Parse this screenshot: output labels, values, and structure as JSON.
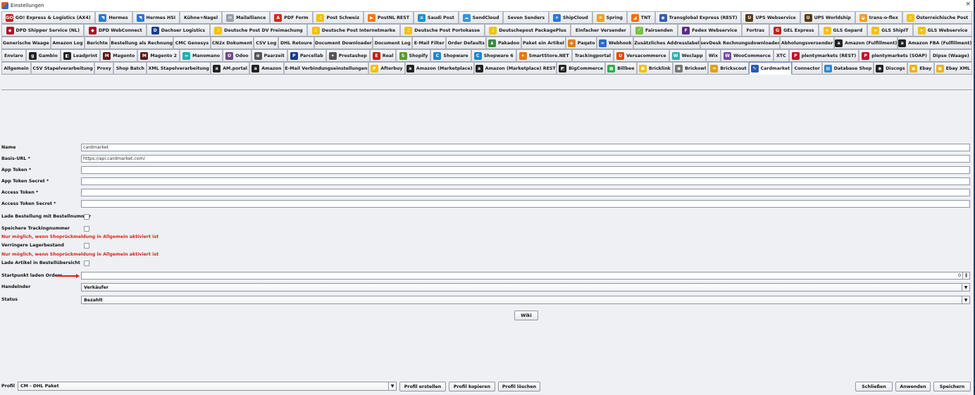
{
  "window": {
    "title": "Einstellungen",
    "close_glyph": "×"
  },
  "tab_rows": [
    [
      {
        "label": "GO! Express & Logistics (AX4)",
        "icon": "go-logo-icon",
        "color": "#c8201e",
        "glyph": "GO"
      },
      {
        "label": "Hermes",
        "icon": "hermes-icon",
        "color": "#2a7ad0",
        "glyph": "◥"
      },
      {
        "label": "Hermes HSI",
        "icon": "hermes-icon",
        "color": "#2a7ad0",
        "glyph": "◥"
      },
      {
        "label": "Kühne+Nagel",
        "icon": "",
        "color": "",
        "glyph": ""
      },
      {
        "label": "Mailalliance",
        "icon": "mail-icon",
        "color": "#9aa0aa",
        "glyph": "✉"
      },
      {
        "label": "PDF Form",
        "icon": "pdf-icon",
        "color": "#d8271c",
        "glyph": "A"
      },
      {
        "label": "Post Schweiz",
        "icon": "post-horn-icon",
        "color": "#f2c200",
        "glyph": "♫"
      },
      {
        "label": "PostNL REST",
        "icon": "postnl-icon",
        "color": "#f07a10",
        "glyph": "▶"
      },
      {
        "label": "Saudi Post",
        "icon": "saudi-post-icon",
        "color": "#1e90d0",
        "glyph": "≋"
      },
      {
        "label": "SendCloud",
        "icon": "cloud-icon",
        "color": "#2a9ae0",
        "glyph": "☁"
      },
      {
        "label": "Seven Senders",
        "icon": "",
        "color": "",
        "glyph": ""
      },
      {
        "label": "ShipCloud",
        "icon": "shipcloud-icon",
        "color": "#2a7ad0",
        "glyph": "✢"
      },
      {
        "label": "Spring",
        "icon": "spring-icon",
        "color": "#f0a020",
        "glyph": "✲"
      },
      {
        "label": "TNT",
        "icon": "tnt-icon",
        "color": "#f07010",
        "glyph": "◢"
      },
      {
        "label": "Transglobal Express (REST)",
        "icon": "globe-icon",
        "color": "#3a5ab0",
        "glyph": "◉"
      },
      {
        "label": "UPS Webservice",
        "icon": "ups-icon",
        "color": "#5a3a10",
        "glyph": "U"
      },
      {
        "label": "UPS Worldship",
        "icon": "ups-icon",
        "color": "#5a3a10",
        "glyph": "U"
      },
      {
        "label": "trans-o-flex",
        "icon": "trans-o-flex-icon",
        "color": "#f0a020",
        "glyph": "◒"
      },
      {
        "label": "Österreichische Post",
        "icon": "post-horn-icon",
        "color": "#f2c200",
        "glyph": "♫"
      }
    ],
    [
      {
        "label": "DPD Shipper Service (NL)",
        "icon": "dpd-cube-icon",
        "color": "#b0102a",
        "glyph": "◆"
      },
      {
        "label": "DPD WebConnect",
        "icon": "dpd-cube-icon",
        "color": "#b0102a",
        "glyph": "◆"
      },
      {
        "label": "Dachser Logistics",
        "icon": "dachser-icon",
        "color": "#1a3f8a",
        "glyph": "D"
      },
      {
        "label": "Deutsche Post DV Freimachung",
        "icon": "post-horn-icon",
        "color": "#f2c200",
        "glyph": "♫"
      },
      {
        "label": "Deutsche Post Internetmarke",
        "icon": "post-horn-icon",
        "color": "#f2c200",
        "glyph": "♫"
      },
      {
        "label": "Deutsche Post Portokasse",
        "icon": "post-horn-icon",
        "color": "#f2c200",
        "glyph": "♫"
      },
      {
        "label": "Deutschepost PackagePlus",
        "icon": "post-horn-icon",
        "color": "#f2c200",
        "glyph": "♫"
      },
      {
        "label": "Einfacher Versender",
        "icon": "",
        "color": "",
        "glyph": ""
      },
      {
        "label": "Fairsenden",
        "icon": "fairsenden-icon",
        "color": "#7ac040",
        "glyph": "⟋"
      },
      {
        "label": "Fedex Webservice",
        "icon": "fedex-icon",
        "color": "#5a2a8a",
        "glyph": "F"
      },
      {
        "label": "Fortras",
        "icon": "",
        "color": "",
        "glyph": ""
      },
      {
        "label": "GEL Express",
        "icon": "gel-icon",
        "color": "#c8201e",
        "glyph": "G"
      },
      {
        "label": "GLS Gepard",
        "icon": "gls-icon",
        "color": "#f2c200",
        "glyph": "="
      },
      {
        "label": "GLS ShipIT",
        "icon": "gls-icon",
        "color": "#f2c200",
        "glyph": "="
      },
      {
        "label": "GLS Webservice",
        "icon": "gls-icon",
        "color": "#f2c200",
        "glyph": "="
      }
    ],
    [
      {
        "label": "Generische Waage",
        "icon": "",
        "color": "",
        "glyph": ""
      },
      {
        "label": "Amazon Log",
        "icon": "",
        "color": "",
        "glyph": ""
      },
      {
        "label": "Berichte",
        "icon": "",
        "color": "",
        "glyph": ""
      },
      {
        "label": "Bestellung als Rechnung",
        "icon": "",
        "color": "",
        "glyph": ""
      },
      {
        "label": "CMC Genesys",
        "icon": "",
        "color": "",
        "glyph": ""
      },
      {
        "label": "CN2x Dokument",
        "icon": "",
        "color": "",
        "glyph": ""
      },
      {
        "label": "CSV Log",
        "icon": "",
        "color": "",
        "glyph": ""
      },
      {
        "label": "DHL Retoure",
        "icon": "",
        "color": "",
        "glyph": ""
      },
      {
        "label": "Document Downloader",
        "icon": "",
        "color": "",
        "glyph": ""
      },
      {
        "label": "Document Log",
        "icon": "",
        "color": "",
        "glyph": ""
      },
      {
        "label": "E-Mail Filter",
        "icon": "",
        "color": "",
        "glyph": ""
      },
      {
        "label": "Order Defaults",
        "icon": "",
        "color": "",
        "glyph": ""
      },
      {
        "label": "Pakadoo",
        "icon": "pakadoo-icon",
        "color": "#3a8a3a",
        "glyph": "♟"
      },
      {
        "label": "Paket ein Artikel",
        "icon": "",
        "color": "",
        "glyph": ""
      },
      {
        "label": "Paqato",
        "icon": "paqato-icon",
        "color": "#e08010",
        "glyph": "◈"
      },
      {
        "label": "Webhook",
        "icon": "webhook-icon",
        "color": "#2a6ad0",
        "glyph": "∞"
      },
      {
        "label": "Zusätzliches Addresslabel",
        "icon": "",
        "color": "",
        "glyph": ""
      },
      {
        "label": "sevDesk Rechnungsdownloader",
        "icon": "",
        "color": "",
        "glyph": ""
      },
      {
        "label": "Abholungsversender",
        "icon": "",
        "color": "",
        "glyph": ""
      },
      {
        "label": "Amazon (Fulfillment)",
        "icon": "amazon-icon",
        "color": "#222",
        "glyph": "a"
      },
      {
        "label": "Amazon FBA (Fulfillment)",
        "icon": "amazon-icon",
        "color": "#222",
        "glyph": "a"
      }
    ],
    [
      {
        "label": "Enviaro",
        "icon": "",
        "color": "",
        "glyph": ""
      },
      {
        "label": "Gambio",
        "icon": "gambio-icon",
        "color": "#222",
        "glyph": "g"
      },
      {
        "label": "Leadprint",
        "icon": "leadprint-icon",
        "color": "#222",
        "glyph": "◧"
      },
      {
        "label": "Magento",
        "icon": "magento-icon",
        "color": "#5a1a1a",
        "glyph": "M"
      },
      {
        "label": "Magento 2",
        "icon": "magento-icon",
        "color": "#5a1a1a",
        "glyph": "M"
      },
      {
        "label": "Manomano",
        "icon": "manomano-icon",
        "color": "#20b0b0",
        "glyph": "∞"
      },
      {
        "label": "Odoo",
        "icon": "odoo-icon",
        "color": "#6a4a8a",
        "glyph": "O"
      },
      {
        "label": "Paarzeit",
        "icon": "paarzeit-icon",
        "color": "#555",
        "glyph": "⊛"
      },
      {
        "label": "Parcellab",
        "icon": "parcellab-icon",
        "color": "#1a3a8a",
        "glyph": "P"
      },
      {
        "label": "Prestashop",
        "icon": "prestashop-icon",
        "color": "#555",
        "glyph": "✦"
      },
      {
        "label": "Real",
        "icon": "real-icon",
        "color": "#c8201e",
        "glyph": "E"
      },
      {
        "label": "Shopify",
        "icon": "shopify-icon",
        "color": "#5a9a2a",
        "glyph": "S"
      },
      {
        "label": "Shopware",
        "icon": "shopware-icon",
        "color": "#1a8ad0",
        "glyph": "C"
      },
      {
        "label": "Shopware 6",
        "icon": "shopware-icon",
        "color": "#1a8ad0",
        "glyph": "C"
      },
      {
        "label": "SmartStore.NET",
        "icon": "smartstore-icon",
        "color": "#e07a10",
        "glyph": "✶"
      },
      {
        "label": "Trackingportal",
        "icon": "",
        "color": "",
        "glyph": ""
      },
      {
        "label": "Versacommerce",
        "icon": "versacommerce-icon",
        "color": "#e04a10",
        "glyph": "U"
      },
      {
        "label": "Weclapp",
        "icon": "weclapp-icon",
        "color": "#2ab0b0",
        "glyph": "W"
      },
      {
        "label": "Wix",
        "icon": "",
        "color": "",
        "glyph": ""
      },
      {
        "label": "WooCommerce",
        "icon": "woocommerce-icon",
        "color": "#7a4aa8",
        "glyph": "W"
      },
      {
        "label": "XTC",
        "icon": "",
        "color": "",
        "glyph": ""
      },
      {
        "label": "plentymarkets (REST)",
        "icon": "plentymarkets-icon",
        "color": "#c8102a",
        "glyph": "P"
      },
      {
        "label": "plentymarkets (SOAP)",
        "icon": "plentymarkets-icon",
        "color": "#c8102a",
        "glyph": "P"
      },
      {
        "label": "Dipse (Waage)",
        "icon": "",
        "color": "",
        "glyph": ""
      }
    ],
    [
      {
        "label": "Allgemein",
        "icon": "",
        "color": "",
        "glyph": ""
      },
      {
        "label": "CSV Stapelverarbeitung",
        "icon": "",
        "color": "",
        "glyph": ""
      },
      {
        "label": "Proxy",
        "icon": "",
        "color": "",
        "glyph": ""
      },
      {
        "label": "Shop Batch",
        "icon": "",
        "color": "",
        "glyph": ""
      },
      {
        "label": "XML Stapelverarbeitung",
        "icon": "",
        "color": "",
        "glyph": ""
      },
      {
        "label": "AM.portal",
        "icon": "amazon-icon",
        "color": "#222",
        "glyph": "a"
      },
      {
        "label": "Amazon",
        "icon": "amazon-icon",
        "color": "#222",
        "glyph": "a"
      },
      {
        "label": "E-Mail Verbindungseinstellungen",
        "icon": "",
        "color": "",
        "glyph": ""
      },
      {
        "label": "Afterbuy",
        "icon": "afterbuy-icon",
        "color": "#f2c200",
        "glyph": "◤"
      },
      {
        "label": "Amazon (Marketplace)",
        "icon": "amazon-icon",
        "color": "#222",
        "glyph": "a"
      },
      {
        "label": "Amazon (Marketplace) REST",
        "icon": "amazon-icon",
        "color": "#222",
        "glyph": "a"
      },
      {
        "label": "BigCommerce",
        "icon": "bigcommerce-icon",
        "color": "#222",
        "glyph": "◩"
      },
      {
        "label": "Billbee",
        "icon": "billbee-icon",
        "color": "#2ab04a",
        "glyph": "▦"
      },
      {
        "label": "Bricklink",
        "icon": "bricklink-icon",
        "color": "#f2c200",
        "glyph": "⬢"
      },
      {
        "label": "Brickowl",
        "icon": "brickowl-icon",
        "color": "#777",
        "glyph": "◉"
      },
      {
        "label": "Brickscout",
        "icon": "brickscout-icon",
        "color": "#e0a020",
        "glyph": "≈"
      },
      {
        "label": "Cardmarket",
        "icon": "cardmarket-icon",
        "color": "#2a5ab0",
        "glyph": "✎",
        "selected": true
      },
      {
        "label": "Connector",
        "icon": "",
        "color": "",
        "glyph": ""
      },
      {
        "label": "Database Shop",
        "icon": "database-icon",
        "color": "#2a8ad0",
        "glyph": "▤"
      },
      {
        "label": "Discogs",
        "icon": "discogs-icon",
        "color": "#222",
        "glyph": "◉"
      },
      {
        "label": "Ebay",
        "icon": "ebay-icon",
        "color": "#f0b020",
        "glyph": "▣"
      },
      {
        "label": "Ebay XML",
        "icon": "ebay-icon",
        "color": "#f0b020",
        "glyph": "▣"
      }
    ]
  ],
  "form": {
    "name_label": "Name",
    "name_value": "cardmarket",
    "base_url_label": "Basis-URL *",
    "base_url_value": "https://api.cardmarket.com/",
    "app_token_label": "App Token *",
    "app_token_secret_label": "App Token Secret *",
    "access_token_label": "Access Token *",
    "access_token_secret_label": "Access Token Secret *",
    "load_order_label": "Lade Bestellung mit Bestellnummer",
    "save_tracking_label": "Speichere Trackingnummer",
    "warning_1": "Nur möglich, wenn Shoprückmeldung in Allgemein aktiviert ist",
    "reduce_stock_label": "Verringere Lagerbestand",
    "warning_2": "Nur möglich, wenn Shoprückmeldung in Allgemein aktiviert ist",
    "load_articles_label": "Lade Artikel in Bestellübersicht",
    "start_point_label": "Startpunkt laden Orders",
    "start_point_value": "0",
    "trader_label": "Handelnder",
    "trader_value": "Verkäufer",
    "status_label": "Status",
    "status_value": "Bezahlt",
    "wiki_button": "Wiki"
  },
  "footer": {
    "profile_label": "Profil",
    "profile_value": "CM - DHL Paket",
    "create_profile": "Profil erstellen",
    "copy_profile": "Profil kopieren",
    "delete_profile": "Profil löschen",
    "close": "Schließen",
    "apply": "Anwenden",
    "save": "Speichern"
  },
  "colors": {
    "accent_red": "#e0201a",
    "selected_tab_border": "#6f8fc8",
    "window_border": "#1b3a6b"
  }
}
